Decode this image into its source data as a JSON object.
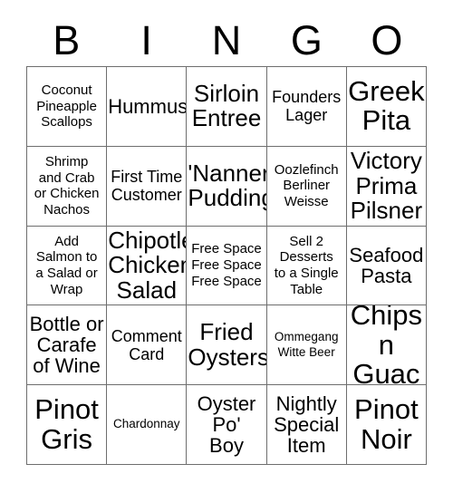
{
  "card": {
    "header_letters": [
      "B",
      "I",
      "N",
      "G",
      "O"
    ],
    "columns": 5,
    "rows": 5,
    "border_color": "#6e6e6e",
    "background_color": "#ffffff",
    "text_color": "#000000",
    "cells": [
      [
        {
          "text": "Coconut\nPineapple\nScallops",
          "size": "sm"
        },
        {
          "text": "Hummus",
          "size": "lg"
        },
        {
          "text": "Sirloin\nEntree",
          "size": "xl"
        },
        {
          "text": "Founders\nLager",
          "size": "md"
        },
        {
          "text": "Greek\nPita",
          "size": "xxl"
        }
      ],
      [
        {
          "text": "Shrimp\nand Crab\nor Chicken\nNachos",
          "size": "sm"
        },
        {
          "text": "First Time\nCustomer",
          "size": "md"
        },
        {
          "text": "'Nanner\nPudding",
          "size": "xl"
        },
        {
          "text": "Oozlefinch\nBerliner\nWeisse",
          "size": "sm"
        },
        {
          "text": "Victory\nPrima\nPilsner",
          "size": "xl"
        }
      ],
      [
        {
          "text": "Add\nSalmon to\na Salad or\nWrap",
          "size": "sm"
        },
        {
          "text": "Chipotle\nChicken\nSalad",
          "size": "xl"
        },
        {
          "text": "Free Space\nFree Space\nFree Space",
          "size": "sm"
        },
        {
          "text": "Sell 2\nDesserts\nto a Single\nTable",
          "size": "sm"
        },
        {
          "text": "Seafood\nPasta",
          "size": "lg"
        }
      ],
      [
        {
          "text": "Bottle or\nCarafe\nof Wine",
          "size": "lg"
        },
        {
          "text": "Comment\nCard",
          "size": "md"
        },
        {
          "text": "Fried\nOysters",
          "size": "xl"
        },
        {
          "text": "Ommegang\nWitte Beer",
          "size": "xs"
        },
        {
          "text": "Chips\nn Guac",
          "size": "xxl"
        }
      ],
      [
        {
          "text": "Pinot\nGris",
          "size": "xxl"
        },
        {
          "text": "Chardonnay",
          "size": "xs"
        },
        {
          "text": "Oyster\nPo'\nBoy",
          "size": "lg"
        },
        {
          "text": "Nightly\nSpecial\nItem",
          "size": "lg"
        },
        {
          "text": "Pinot\nNoir",
          "size": "xxl"
        }
      ]
    ]
  }
}
